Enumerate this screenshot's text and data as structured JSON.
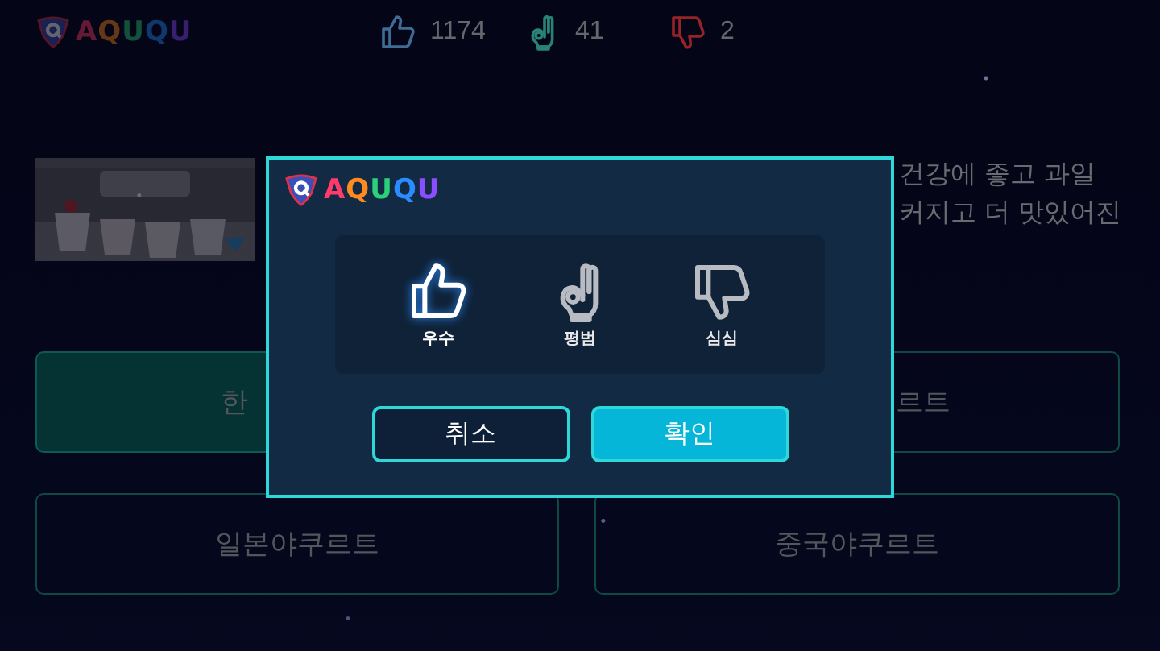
{
  "header": {
    "logo": "AQUQU",
    "stats": [
      {
        "kind": "like",
        "count": "1174"
      },
      {
        "kind": "ok",
        "count": "41"
      },
      {
        "kind": "dislike",
        "count": "2"
      }
    ]
  },
  "question": {
    "image": {
      "kind": "picture"
    },
    "lines": [
      "건강에 좋고 과일",
      "커지고 더 맛있어진"
    ]
  },
  "answers": [
    {
      "label": "한",
      "selected": true
    },
    {
      "label": "르트",
      "selected": false
    },
    {
      "label": "일본야쿠르트",
      "selected": false
    },
    {
      "label": "중국야쿠르트",
      "selected": false
    }
  ],
  "dialog": {
    "logo": "AQUQU",
    "ratings": [
      {
        "kind": "like",
        "label": "우수",
        "selected": true
      },
      {
        "kind": "ok",
        "label": "평범",
        "selected": false
      },
      {
        "kind": "dislike",
        "label": "심심",
        "selected": false
      }
    ],
    "buttons": [
      {
        "kind": "cancel",
        "label": "취소"
      },
      {
        "kind": "confirm",
        "label": "확인"
      }
    ]
  }
}
